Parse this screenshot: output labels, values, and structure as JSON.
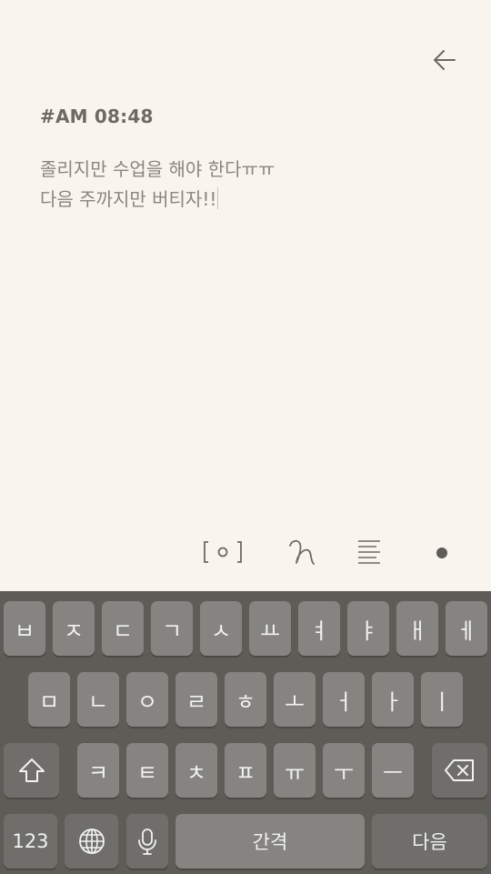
{
  "note": {
    "title": "#AM 08:48",
    "lines": [
      "졸리지만 수업을 해야 한다ㅠㅠ",
      "다음 주까지만 버티자!!"
    ]
  },
  "toolbar": {
    "icons": [
      "camera-frame-icon",
      "pen-icon",
      "align-icon",
      "color-dot-icon"
    ]
  },
  "keyboard": {
    "row1": [
      "ㅂ",
      "ㅈ",
      "ㄷ",
      "ㄱ",
      "ㅅ",
      "ㅛ",
      "ㅕ",
      "ㅑ",
      "ㅐ",
      "ㅔ"
    ],
    "row2": [
      "ㅁ",
      "ㄴ",
      "ㅇ",
      "ㄹ",
      "ㅎ",
      "ㅗ",
      "ㅓ",
      "ㅏ",
      "ㅣ"
    ],
    "row3": [
      "ㅋ",
      "ㅌ",
      "ㅊ",
      "ㅍ",
      "ㅠ",
      "ㅜ",
      "ㅡ"
    ],
    "numbers_label": "123",
    "space_label": "간격",
    "return_label": "다음",
    "icons": [
      "shift-icon",
      "backspace-icon",
      "globe-icon",
      "microphone-icon"
    ]
  },
  "colors": {
    "background": "#f9f5ee",
    "title": "#6e6962",
    "body_text": "#8a857e",
    "keyboard_bg": "#5d5c57",
    "key": "#858481",
    "key_dark": "#6f6e6a"
  }
}
